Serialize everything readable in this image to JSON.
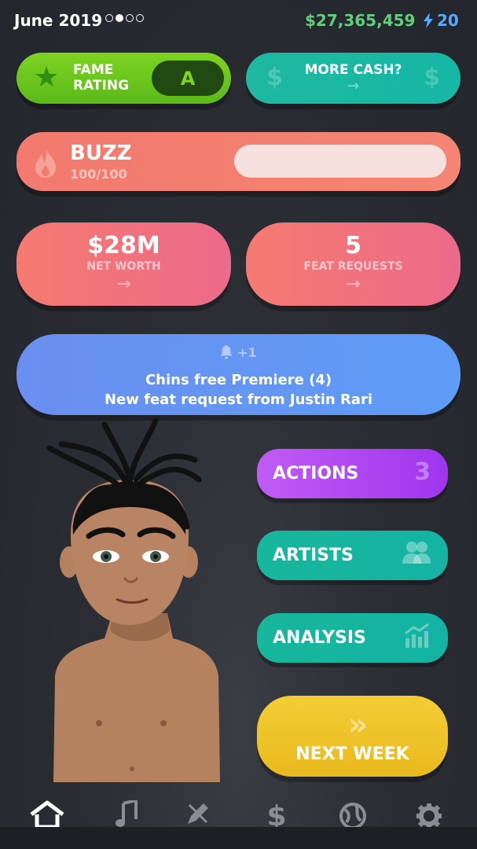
{
  "header": {
    "date": "June 2019",
    "page_indicator": {
      "count": 4,
      "active": 1
    },
    "cash": "$27,365,459",
    "energy": "20"
  },
  "fame": {
    "label_line1": "FAME",
    "label_line2": "RATING",
    "grade": "A"
  },
  "more_cash": {
    "label": "MORE CASH?",
    "arrow": "→",
    "symbol": "$"
  },
  "buzz": {
    "title": "BUZZ",
    "value": "100/100",
    "fraction": 1.0
  },
  "net_worth": {
    "value": "$28M",
    "label": "NET WORTH",
    "arrow": "→"
  },
  "feat_requests": {
    "value": "5",
    "label": "FEAT REQUESTS",
    "arrow": "→"
  },
  "notification": {
    "count": "+1",
    "line1": "Chins free Premiere (4)",
    "line2": "New feat request from Justin Rari"
  },
  "menu": {
    "actions": {
      "label": "ACTIONS",
      "count": "3"
    },
    "artists": {
      "label": "ARTISTS",
      "icon": "people-icon"
    },
    "analysis": {
      "label": "ANALYSIS",
      "icon": "chart-icon"
    },
    "next_week": {
      "label": "NEXT WEEK",
      "icon": "double-chevron-icon"
    }
  },
  "bottom_nav": [
    "home-icon",
    "music-note-icon",
    "pencil-icon",
    "dollar-icon",
    "globe-icon",
    "gear-icon"
  ],
  "colors": {
    "cash_green": "#5fd07a",
    "energy_blue": "#5aa8ff",
    "fame_green": "#7ed321",
    "teal": "#16b7a5",
    "buzz_coral": "#f27a6e",
    "notif_blue": "#6a8ff0",
    "actions_purple": "#b04df2",
    "next_week_yellow": "#f0c42d"
  }
}
